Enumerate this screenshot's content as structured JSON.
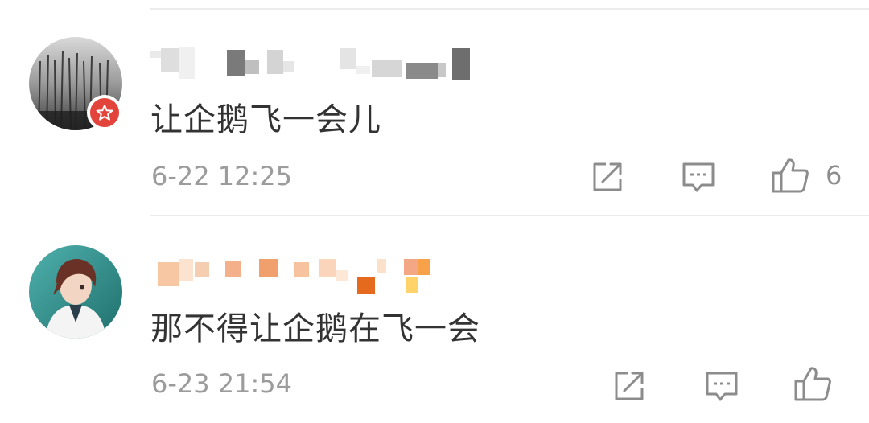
{
  "comments": [
    {
      "text": "让企鹅飞一会儿",
      "time": "6-22 12:25",
      "like_count": "6"
    },
    {
      "text": "那不得让企鹅在飞一会",
      "time": "6-23 21:54",
      "like_count": ""
    }
  ],
  "colors": {
    "badge": "#e2433b",
    "text": "#333333",
    "meta": "#9c9c9c",
    "icon": "#8c8c8c"
  }
}
